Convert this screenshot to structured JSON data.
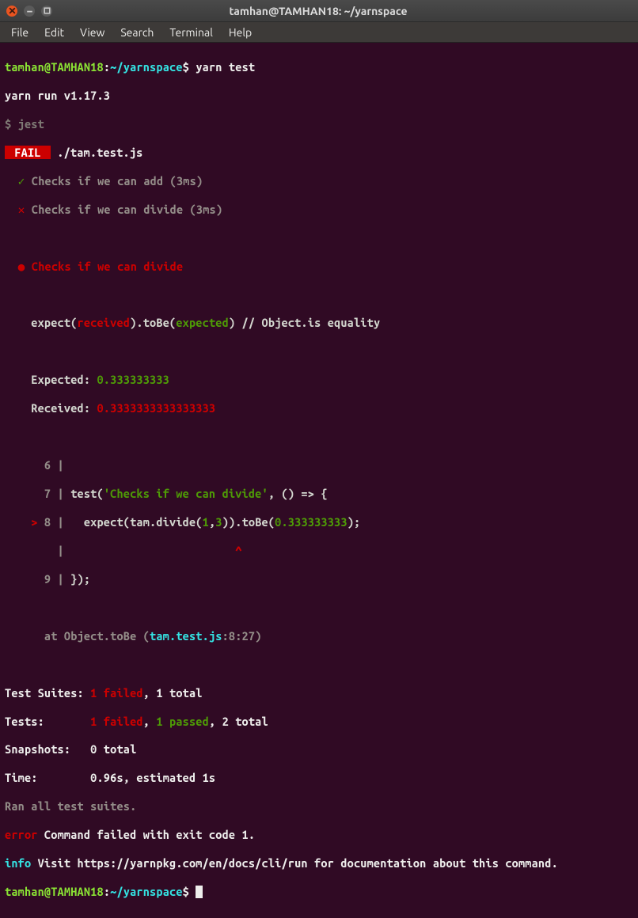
{
  "titlebar": {
    "title": "tamhan@TAMHAN18: ~/yarnspace"
  },
  "menu": {
    "file": "File",
    "edit": "Edit",
    "view": "View",
    "search": "Search",
    "terminal": "Terminal",
    "help": "Help"
  },
  "prompt": {
    "userhost": "tamhan@TAMHAN18",
    "sep": ":",
    "path": "~/yarnspace",
    "sigil": "$"
  },
  "cmd": {
    "yarntest": "yarn test"
  },
  "run": {
    "version": "yarn run v1.17.3",
    "jest": "$ jest"
  },
  "fail": {
    "badge": " FAIL ",
    "file": "./tam.test.js"
  },
  "tests": {
    "pass_line": "Checks if we can add (3ms)",
    "fail_line": "Checks if we can divide (3ms)",
    "block_title": "Checks if we can divide"
  },
  "expect_line": {
    "a": "    expect(",
    "received": "received",
    "b": ").toBe(",
    "expected": "expected",
    "c": ") // Object.is equality"
  },
  "expected": {
    "label": "    Expected: ",
    "val": "0.333333333"
  },
  "received": {
    "label": "    Received: ",
    "val": "0.3333333333333333"
  },
  "code": {
    "l6n": "      6 |",
    "l7n": "      7 |",
    "l7a": " test(",
    "l7str": "'Checks if we can divide'",
    "l7b": ", () => {",
    "l8mark": "    > ",
    "l8n": "8 |",
    "l8a": "   expect(tam.divide(",
    "l8num1": "1",
    "l8comma": ",",
    "l8num2": "3",
    "l8b": ")).toBe(",
    "l8val": "0.333333333",
    "l8c": ");",
    "caretline": "        |                          ",
    "caret": "^",
    "l9n": "      9 |",
    "l9a": " });"
  },
  "stack": {
    "a": "      at Object.toBe (",
    "file": "tam.test.js",
    "loc": ":8:27)"
  },
  "summary": {
    "suites_lbl": "Test Suites: ",
    "suites_fail": "1 failed",
    "suites_rest": ", 1 total",
    "tests_lbl": "Tests:       ",
    "tests_fail": "1 failed",
    "tests_mid": ", ",
    "tests_pass": "1 passed",
    "tests_rest": ", 2 total",
    "snaps_lbl": "Snapshots:   ",
    "snaps_val": "0 total",
    "time_lbl": "Time:        ",
    "time_val": "0.96s, estimated 1s",
    "ran": "Ran all test suites."
  },
  "err": {
    "tag": "error",
    "msg": " Command failed with exit code 1."
  },
  "info": {
    "tag": "info",
    "a": " Visit ",
    "url": "https://yarnpkg.com/en/docs/cli/run",
    "b": " for documentation about this command."
  }
}
